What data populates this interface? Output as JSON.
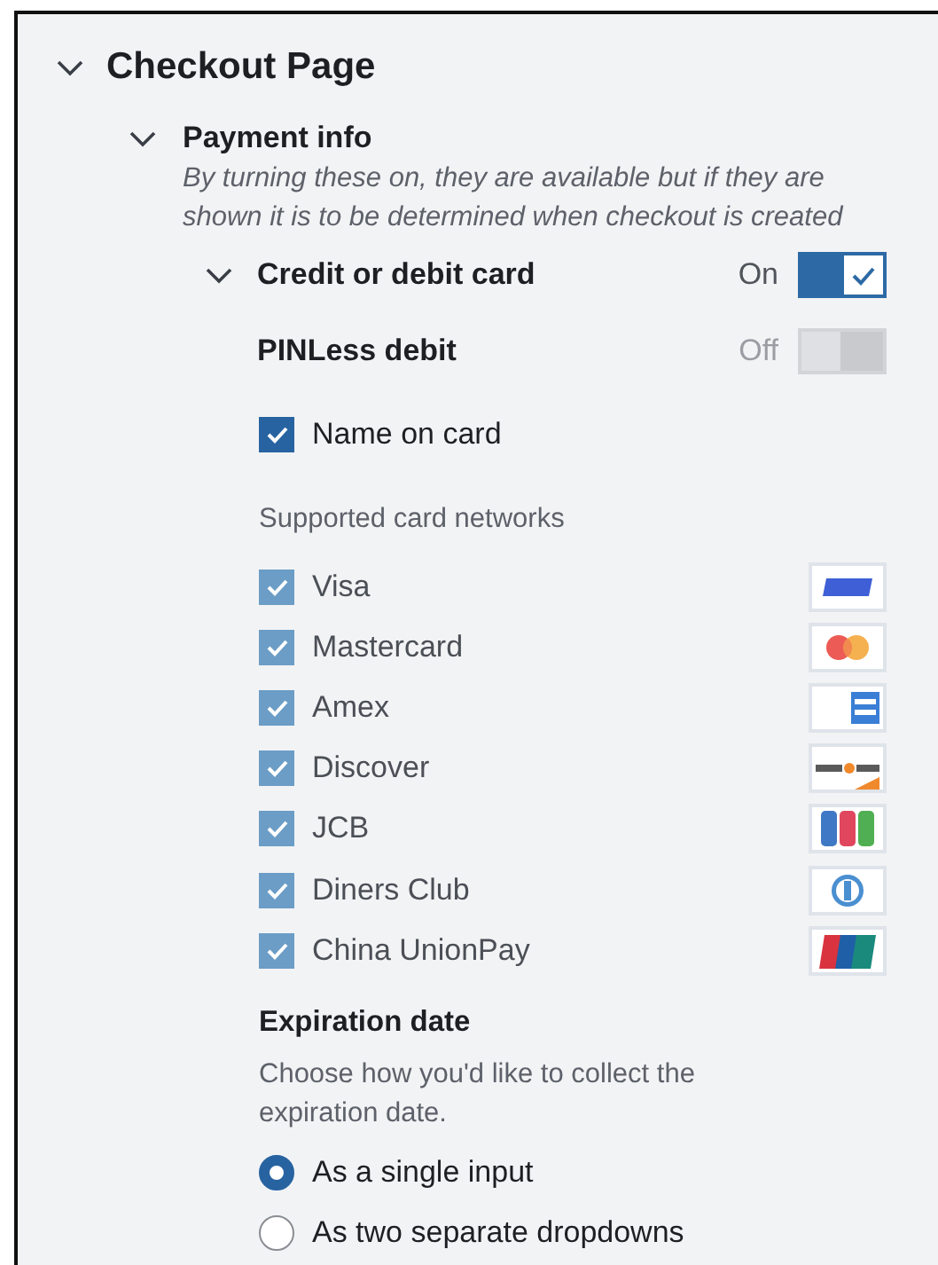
{
  "section": {
    "title": "Checkout Page",
    "expanded": true
  },
  "payment_info": {
    "title": "Payment info",
    "expanded": true,
    "description": "By turning these on, they are available but if they are shown it is to be determined when checkout is created"
  },
  "methods": [
    {
      "label": "Credit or debit card",
      "expanded": true,
      "on": true,
      "state_label": "On"
    },
    {
      "label": "PINLess debit",
      "on": false,
      "state_label": "Off"
    }
  ],
  "name_on_card": {
    "label": "Name on card",
    "checked": true,
    "disabled": false
  },
  "networks_heading": "Supported card networks",
  "networks": [
    {
      "label": "Visa",
      "checked": true,
      "disabled": true,
      "kind": "visa"
    },
    {
      "label": "Mastercard",
      "checked": true,
      "disabled": true,
      "kind": "mastercard"
    },
    {
      "label": "Amex",
      "checked": true,
      "disabled": true,
      "kind": "amex"
    },
    {
      "label": "Discover",
      "checked": true,
      "disabled": true,
      "kind": "discover"
    },
    {
      "label": "JCB",
      "checked": true,
      "disabled": true,
      "kind": "jcb"
    },
    {
      "label": "Diners Club",
      "checked": true,
      "disabled": true,
      "kind": "diners"
    },
    {
      "label": "China UnionPay",
      "checked": true,
      "disabled": true,
      "kind": "unionpay"
    }
  ],
  "expiration": {
    "title": "Expiration date",
    "description": "Choose how you'd like to collect the expiration date.",
    "options": [
      {
        "label": "As a single input",
        "selected": true
      },
      {
        "label": "As two separate dropdowns",
        "selected": false
      }
    ]
  }
}
